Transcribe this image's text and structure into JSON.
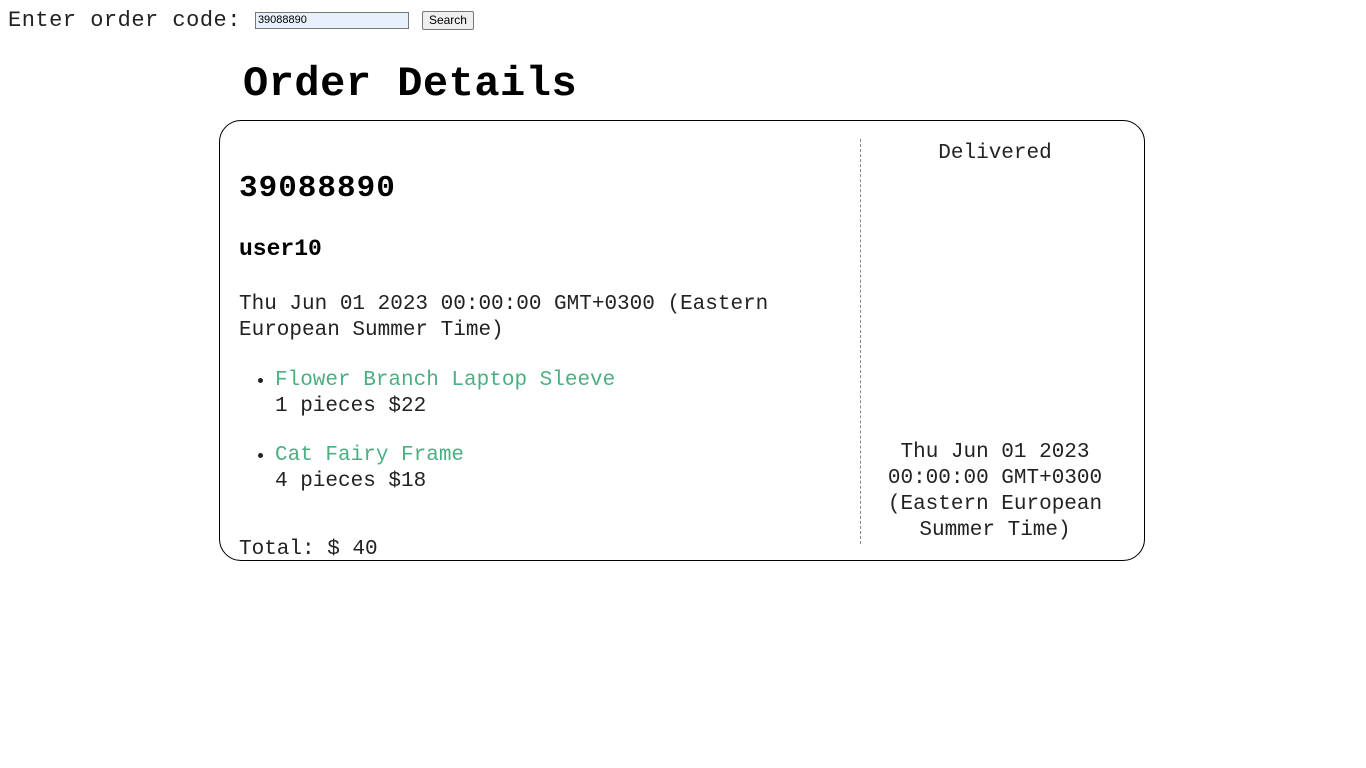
{
  "search": {
    "label": "Enter order code:",
    "input_value": "39088890",
    "button_label": "Search"
  },
  "page": {
    "title": "Order Details"
  },
  "order": {
    "code": "39088890",
    "user": "user10",
    "date": "Thu Jun 01 2023 00:00:00 GMT+0300 (Eastern European Summer Time)",
    "items": [
      {
        "name": "Flower Branch Laptop Sleeve",
        "detail": "1 pieces $22"
      },
      {
        "name": "Cat Fairy Frame",
        "detail": "4 pieces $18"
      }
    ],
    "total": "Total: $ 40",
    "status": "Delivered",
    "delivery_date": "Thu Jun 01 2023 00:00:00 GMT+0300 (Eastern European Summer Time)"
  },
  "colors": {
    "item_link": "#4caf82",
    "input_background": "#e8f0fe"
  }
}
